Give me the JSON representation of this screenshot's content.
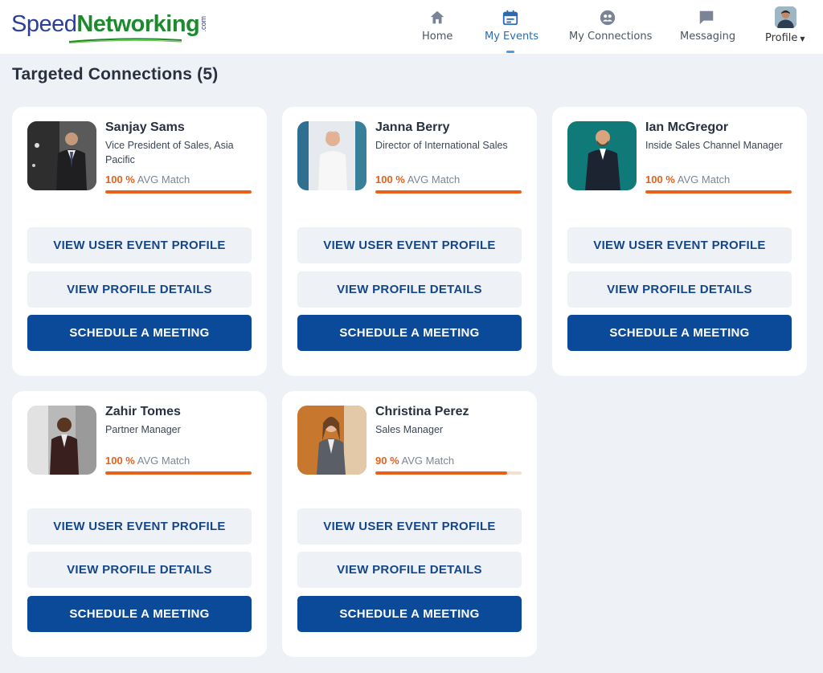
{
  "brand": {
    "speed": "Speed",
    "networking": "Networking",
    "com": ".com"
  },
  "nav": {
    "home": "Home",
    "my_events": "My Events",
    "my_connections": "My Connections",
    "messaging": "Messaging",
    "profile": "Profile"
  },
  "page": {
    "title": "Targeted Connections (5)"
  },
  "buttons": {
    "view_event_profile": "VIEW USER EVENT PROFILE",
    "view_profile_details": "VIEW PROFILE DETAILS",
    "schedule_meeting": "SCHEDULE A MEETING"
  },
  "match_suffix": "AVG Match",
  "colors": {
    "accent": "#e8611a",
    "primary": "#0b4a98",
    "active_nav": "#2b6cb0"
  },
  "connections": [
    {
      "name": "Sanjay Sams",
      "title": "Vice President of Sales, Asia Pacific",
      "match_label": "100 %",
      "match": 1.0
    },
    {
      "name": "Janna Berry",
      "title": "Director of International Sales",
      "match_label": "100 %",
      "match": 1.0
    },
    {
      "name": "Ian McGregor",
      "title": "Inside Sales Channel Manager",
      "match_label": "100 %",
      "match": 1.0
    },
    {
      "name": "Zahir Tomes",
      "title": "Partner Manager",
      "match_label": "100 %",
      "match": 1.0
    },
    {
      "name": "Christina Perez",
      "title": "Sales Manager",
      "match_label": "90 %",
      "match": 0.9
    }
  ]
}
